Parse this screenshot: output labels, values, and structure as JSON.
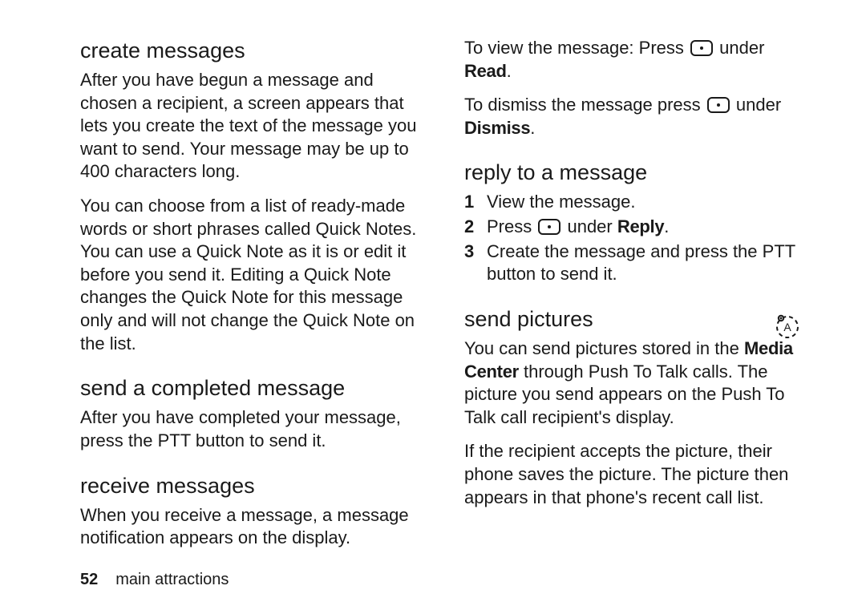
{
  "left": {
    "h_create": "create messages",
    "p_create_1": "After you have begun a message and chosen a recipient, a screen appears that lets you create the text of the message you want to send. Your message may be up to 400 characters long.",
    "p_create_2": "You can choose from a list of ready-made words or short phrases called Quick Notes. You can use a Quick Note as it is or edit it before you send it. Editing a Quick Note changes the Quick Note for this message only and will not change the Quick Note on the list.",
    "h_send_completed": "send a completed message",
    "p_send_completed": "After you have completed your message, press the PTT button to send it.",
    "h_receive": "receive messages",
    "p_receive": "When you receive a message, a message notification appears on the display."
  },
  "right": {
    "view_pre": "To view the message: Press ",
    "view_post_under": " under ",
    "view_bold": "Read",
    "dismiss_pre": "To dismiss the message press ",
    "dismiss_post_under": " under ",
    "dismiss_bold": "Dismiss",
    "h_reply": "reply to a message",
    "step1": "View the message.",
    "step2_pre": "Press ",
    "step2_post_under": " under ",
    "step2_bold": "Reply",
    "step3": "Create the message and press the PTT button to send it.",
    "h_sendpics": "send pictures",
    "sp1_pre": "You can send pictures stored in the ",
    "sp1_b1": "Media Center",
    "sp1_post": " through Push To Talk calls. The picture you send appears on the Push To Talk call recipient's display.",
    "sp2": "If the recipient accepts the picture, their phone saves the picture. The picture then appears in that phone's recent call list."
  },
  "footer": {
    "page": "52",
    "section": "main attractions"
  }
}
